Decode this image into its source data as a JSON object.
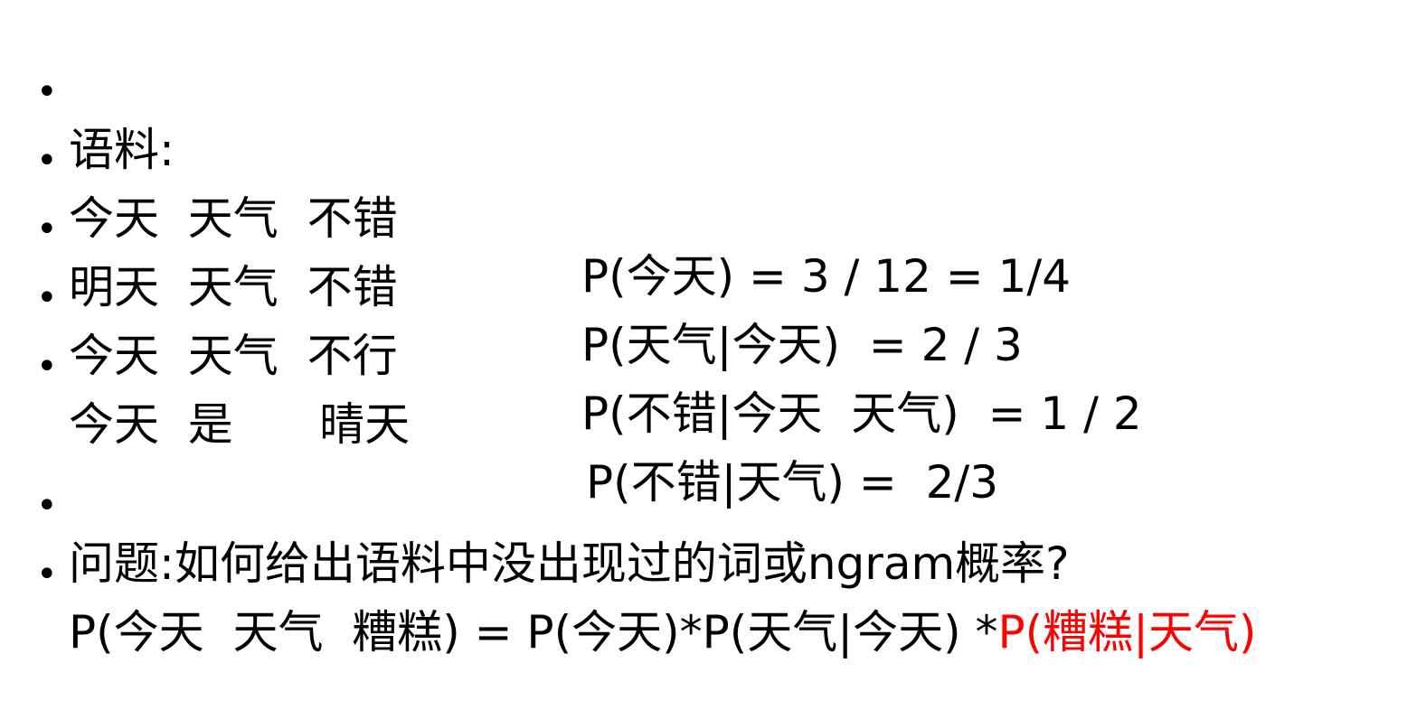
{
  "corpus": {
    "heading": "语料:",
    "rows": [
      {
        "sentence": "今天  天气  不错",
        "formula": "P(今天) = 3 / 12 = 1/4"
      },
      {
        "sentence": "明天  天气  不错",
        "formula": "P(天气|今天)  = 2 / 3"
      },
      {
        "sentence": "今天  天气  不行",
        "formula": "P(不错|今天  天气)  = 1 / 2"
      },
      {
        "sentence": "今天  是      晴天",
        "formula": "P(不错|天气) =  2/3"
      }
    ]
  },
  "question": {
    "text": "问题:如何给出语料中没出现过的词或ngram概率?",
    "formula_black": "P(今天  天气  糟糕) = P(今天)*P(天气|今天) *",
    "formula_red": "P(糟糕|天气)"
  },
  "bullet_symbol": "•",
  "colors": {
    "text": "#000000",
    "highlight": "#ff0000",
    "background": "#ffffff"
  }
}
